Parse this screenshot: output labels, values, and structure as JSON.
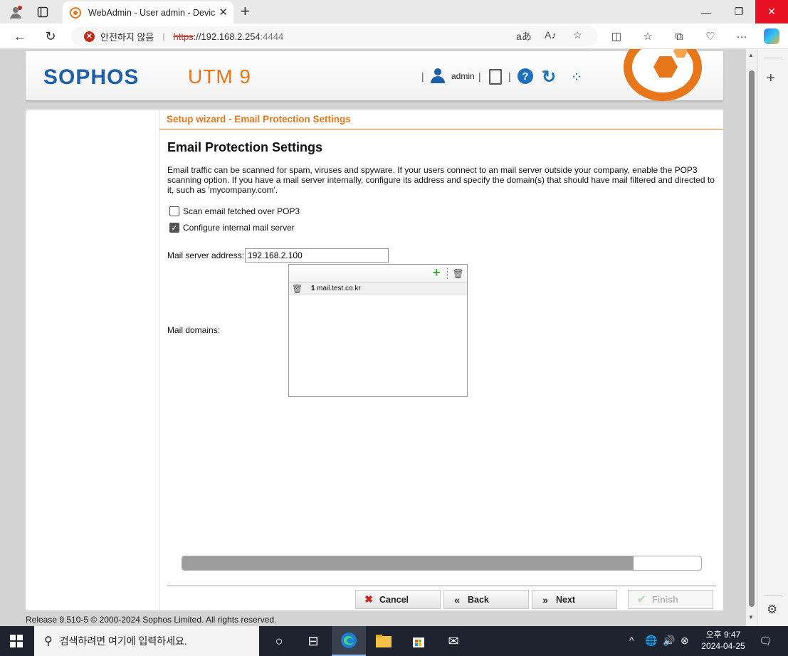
{
  "browser": {
    "tab_title": "WebAdmin - User admin - Devic",
    "not_secure_label": "안전하지 않음",
    "url_scheme": "https",
    "url_host": "://192.168.2.254",
    "url_port": ":4444"
  },
  "header": {
    "brand": "SOPHOS",
    "product": "UTM 9",
    "user": "admin"
  },
  "wizard": {
    "title": "Setup wizard - Email Protection Settings",
    "heading": "Email Protection Settings",
    "description": "Email traffic can be scanned for spam, viruses and spyware. If your users connect to an mail server outside your company, enable the POP3 scanning option. If you have a mail server internally, configure its address and specify the domain(s) that should have mail filtered and directed to it, such as 'mycompany.com'.",
    "scan_pop3": {
      "label": "Scan email fetched over POP3",
      "checked": false
    },
    "internal_server": {
      "label": "Configure internal mail server",
      "checked": true
    },
    "server_address_label": "Mail server address:",
    "server_address_value": "192.168.2.100",
    "mail_domains_label": "Mail domains:",
    "domains": [
      {
        "num": "1",
        "value": "mail.test.co.kr"
      }
    ],
    "progress_fraction": 0.87
  },
  "buttons": {
    "cancel": "Cancel",
    "back": "Back",
    "next": "Next",
    "finish": "Finish"
  },
  "footer": "Release 9.510-5  © 2000-2024 Sophos Limited. All rights reserved.",
  "taskbar": {
    "search_placeholder": "검색하려면 여기에 입력하세요.",
    "time": "오후 9:47",
    "date": "2024-04-25"
  },
  "colors": {
    "brand_blue": "#1d5fa8",
    "accent_orange": "#e8761a"
  }
}
